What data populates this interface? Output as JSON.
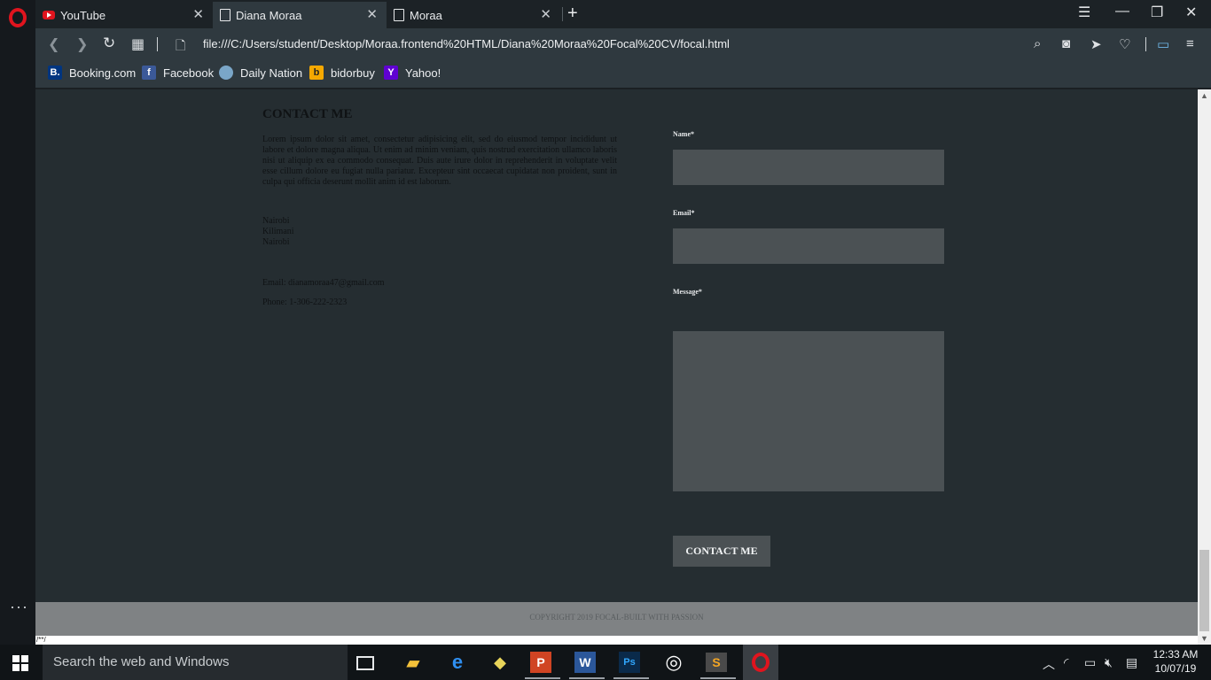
{
  "browser": {
    "tabs": [
      {
        "label": "YouTube",
        "close": "✕"
      },
      {
        "label": "Diana Moraa",
        "close": "✕"
      },
      {
        "label": "Moraa",
        "close": "✕"
      }
    ],
    "new_tab": "+",
    "url": "file:///C:/Users/student/Desktop/Moraa.frontend%20HTML/Diana%20Moraa%20Focal%20CV/focal.html",
    "bookmarks": [
      {
        "label": "Booking.com",
        "icon": "B.",
        "color": "#003580"
      },
      {
        "label": "Facebook",
        "icon": "f",
        "color": "#3b5998"
      },
      {
        "label": "Daily Nation",
        "icon": "",
        "color": "#7aa6c8"
      },
      {
        "label": "bidorbuy",
        "icon": "b",
        "color": "#f5a800"
      },
      {
        "label": "Yahoo!",
        "icon": "Y",
        "color": "#5f01d1"
      }
    ],
    "status_text": "/**/"
  },
  "contact": {
    "title": "CONTACT ME",
    "lorem": "Lorem ipsum dolor sit amet, consectetur adipisicing elit, sed do eiusmod tempor incididunt ut labore et dolore magna aliqua. Ut enim ad minim veniam, quis nostrud exercitation ullamco laboris nisi ut aliquip ex ea commodo consequat. Duis aute irure dolor in reprehenderit in voluptate velit esse cillum dolore eu fugiat nulla pariatur. Excepteur sint occaecat cupidatat non proident, sunt in culpa qui officia deserunt mollit anim id est laborum.",
    "address": [
      "Nairobi",
      "Kilimani",
      "Nairobi"
    ],
    "email": "Email: dianamoraa47@gmail.com",
    "phone": "Phone: 1-306-222-2323"
  },
  "form": {
    "name_label": "Name*",
    "email_label": "Email*",
    "message_label": "Message*",
    "submit_label": "CONTACT ME"
  },
  "footer": {
    "copyright": "COPYRIGHT 2019 FOCAL-BUILT WITH PASSION"
  },
  "taskbar": {
    "search_placeholder": "Search the web and Windows",
    "apps": [
      "task-view",
      "file-explorer",
      "edge",
      "maps",
      "powerpoint",
      "word",
      "photoshop",
      "groove",
      "sublime",
      "opera"
    ],
    "time": "12:33 AM",
    "date": "10/07/19"
  }
}
